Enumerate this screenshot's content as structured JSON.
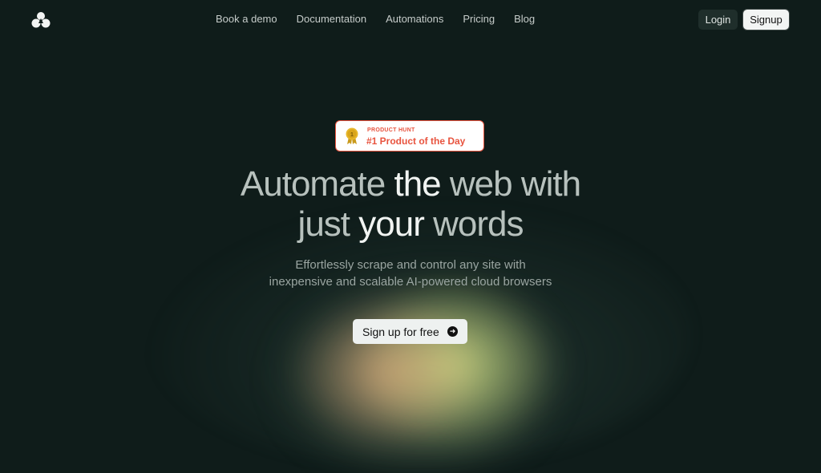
{
  "nav": {
    "logo_icon": "cloud-triangle-logo",
    "links": [
      "Book a demo",
      "Documentation",
      "Automations",
      "Pricing",
      "Blog"
    ],
    "login_label": "Login",
    "signup_label": "Signup"
  },
  "badge": {
    "icon": "medal-icon",
    "small_text": "PRODUCT HUNT",
    "big_text": "#1 Product of the Day",
    "accent": "#e8533e"
  },
  "hero": {
    "line1_part1": "Automate ",
    "line1_part2": "the",
    "line1_part3": " web with",
    "line2_part1": "just ",
    "line2_part2": "your",
    "line2_part3": " words",
    "subtitle_line1": "Effortlessly scrape and control any site with",
    "subtitle_line2": "inexpensive and scalable AI-powered cloud browsers",
    "cta_label": "Sign up for free",
    "cta_icon": "arrow-right-circle-icon"
  },
  "colors": {
    "background": "#0f1c1a",
    "glow_yellow": "#e0f08c",
    "glow_peach": "#ecb080"
  }
}
